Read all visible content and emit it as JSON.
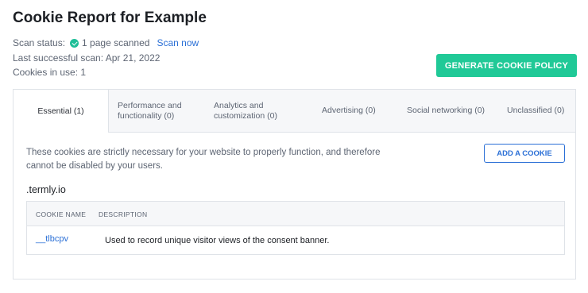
{
  "page": {
    "title": "Cookie Report for Example",
    "scan_status_label": "Scan status:",
    "scan_status_value": "1 page scanned",
    "scan_now": "Scan now",
    "last_scan": "Last successful scan: Apr 21, 2022",
    "cookies_in_use": "Cookies in use: 1",
    "generate_button": "GENERATE COOKIE POLICY"
  },
  "tabs": [
    {
      "label": "Essential (1)",
      "active": true
    },
    {
      "label": "Performance and\nfunctionality (0)",
      "active": false
    },
    {
      "label": "Analytics and\ncustomization (0)",
      "active": false
    },
    {
      "label": "Advertising (0)",
      "active": false
    },
    {
      "label": "Social networking (0)",
      "active": false
    },
    {
      "label": "Unclassified (0)",
      "active": false
    }
  ],
  "content": {
    "description": "These cookies are strictly necessary for your website to properly function, and therefore cannot be disabled by your users.",
    "add_cookie_button": "ADD A COOKIE",
    "domain": ".termly.io",
    "table": {
      "headers": [
        "COOKIE NAME",
        "DESCRIPTION"
      ],
      "rows": [
        {
          "name": "__tlbcpv",
          "description": "Used to record unique visitor views of the consent banner."
        }
      ]
    }
  },
  "colors": {
    "accent_green": "#20c997",
    "link_blue": "#2a6fd6",
    "status_check": "#1fbf98"
  }
}
